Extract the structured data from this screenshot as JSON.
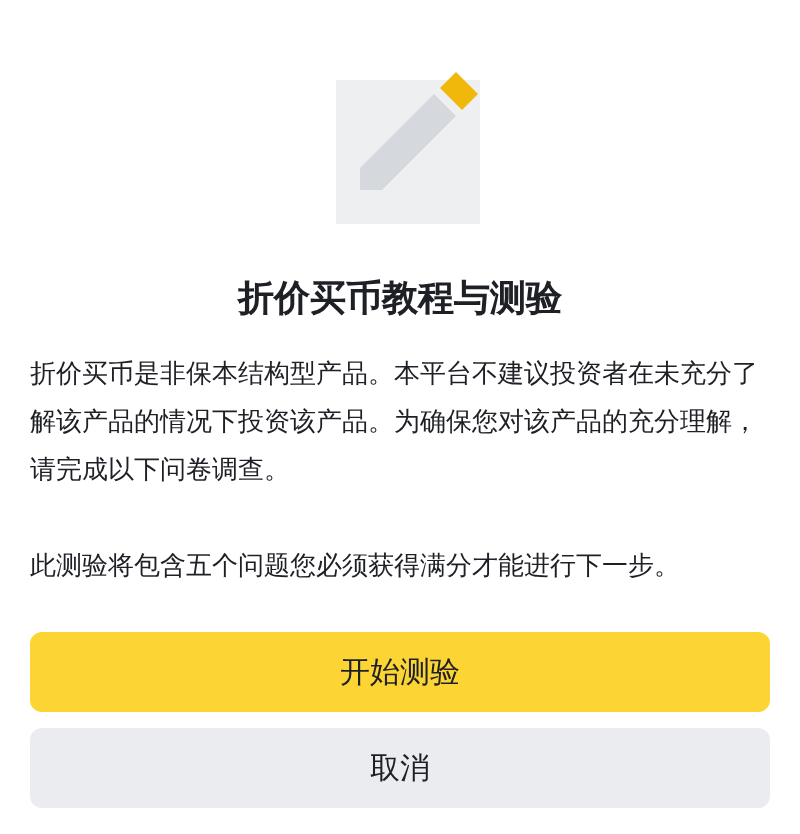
{
  "title": "折价买币教程与测验",
  "paragraphs": [
    "折价买币是非保本结构型产品。本平台不建议投资者在未充分了解该产品的情况下投资该产品。为确保您对该产品的充分理解，请完成以下问卷调查。",
    "此测验将包含五个问题您必须获得满分才能进行下一步。"
  ],
  "buttons": [
    {
      "label": "开始测验",
      "kind": "primary"
    },
    {
      "label": "取消",
      "kind": "secondary"
    }
  ]
}
